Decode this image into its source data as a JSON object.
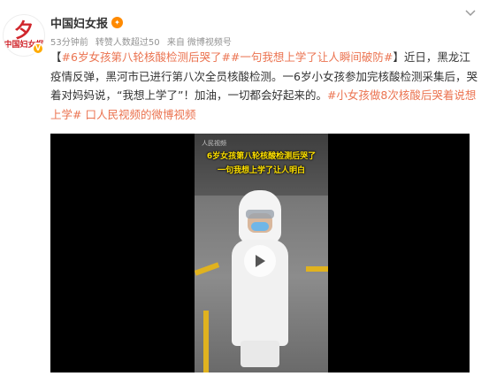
{
  "account": {
    "name": "中国妇女报",
    "avatar_text": "中国妇女报",
    "avatar_symbol": "夕",
    "verified_mark": "V",
    "badge_symbol": "✦"
  },
  "meta": {
    "time": "53分钟前",
    "forwarded": "转赞人数超过50",
    "source_prefix": "来自",
    "source": "微博视频号"
  },
  "post": {
    "bracket_open": "【",
    "topic_link": "#6岁女孩第八轮核酸检测后哭了#",
    "topic_link2": "#一句我想上学了让人瞬间破防#",
    "bracket_close": "】",
    "body": "近日，黑龙江疫情反弹，黑河市已进行第八次全员核酸检测。一6岁小女孩参加完核酸检测采集后，哭着对妈妈说，“我想上学了”！加油，一切都会好起来的。",
    "topic_link3": "#小女孩做8次核酸后哭着说想上学#",
    "video_link": "口人民视频的微博视频"
  },
  "video": {
    "watermark": "人民视频",
    "caption_line1": "6岁女孩第八轮核酸检测后哭了",
    "caption_line2": "一句我想上学了让人明白"
  },
  "colors": {
    "link": "#eb7350",
    "caption": "#ffe100"
  }
}
